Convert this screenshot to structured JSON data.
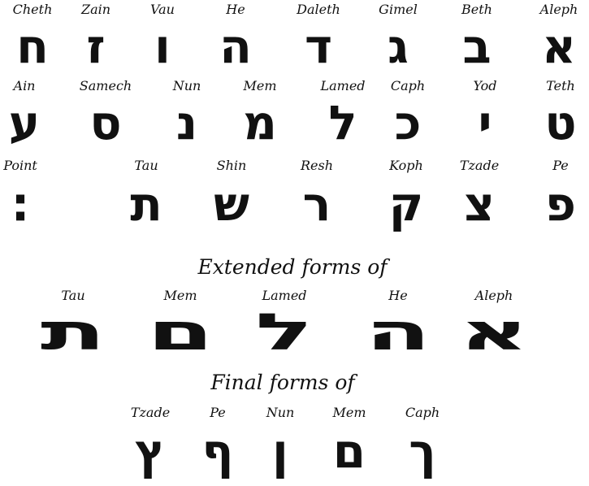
{
  "rows": [
    [
      {
        "name": "Cheth",
        "letter": "ח"
      },
      {
        "name": "Zain",
        "letter": "ז"
      },
      {
        "name": "Vau",
        "letter": "ו"
      },
      {
        "name": "He",
        "letter": "ה"
      },
      {
        "name": "Daleth",
        "letter": "ד"
      },
      {
        "name": "Gimel",
        "letter": "ג"
      },
      {
        "name": "Beth",
        "letter": "ב"
      },
      {
        "name": "Aleph",
        "letter": "א"
      }
    ],
    [
      {
        "name": "Ain",
        "letter": "ע"
      },
      {
        "name": "Samech",
        "letter": "ס"
      },
      {
        "name": "Nun",
        "letter": "נ"
      },
      {
        "name": "Mem",
        "letter": "מ"
      },
      {
        "name": "Lamed",
        "letter": "ל"
      },
      {
        "name": "Caph",
        "letter": "כ"
      },
      {
        "name": "Yod",
        "letter": "י"
      },
      {
        "name": "Teth",
        "letter": "ט"
      }
    ],
    [
      {
        "name": "Point",
        "letter": "׃"
      },
      {
        "name": "Tau",
        "letter": "ת"
      },
      {
        "name": "Shin",
        "letter": "ש"
      },
      {
        "name": "Resh",
        "letter": "ר"
      },
      {
        "name": "Koph",
        "letter": "ק"
      },
      {
        "name": "Tzade",
        "letter": "צ"
      },
      {
        "name": "Pe",
        "letter": "פ"
      }
    ]
  ],
  "extended": {
    "heading": "Extended forms of",
    "items": [
      {
        "name": "Tau",
        "letter": "ת"
      },
      {
        "name": "Mem",
        "letter": "ם"
      },
      {
        "name": "Lamed",
        "letter": "ל"
      },
      {
        "name": "He",
        "letter": "ה"
      },
      {
        "name": "Aleph",
        "letter": "א"
      }
    ]
  },
  "final": {
    "heading": "Final forms of",
    "items": [
      {
        "name": "Tzade",
        "letter": "ץ"
      },
      {
        "name": "Pe",
        "letter": "ף"
      },
      {
        "name": "Nun",
        "letter": "ן"
      },
      {
        "name": "Mem",
        "letter": "ם"
      },
      {
        "name": "Caph",
        "letter": "ך"
      }
    ]
  }
}
